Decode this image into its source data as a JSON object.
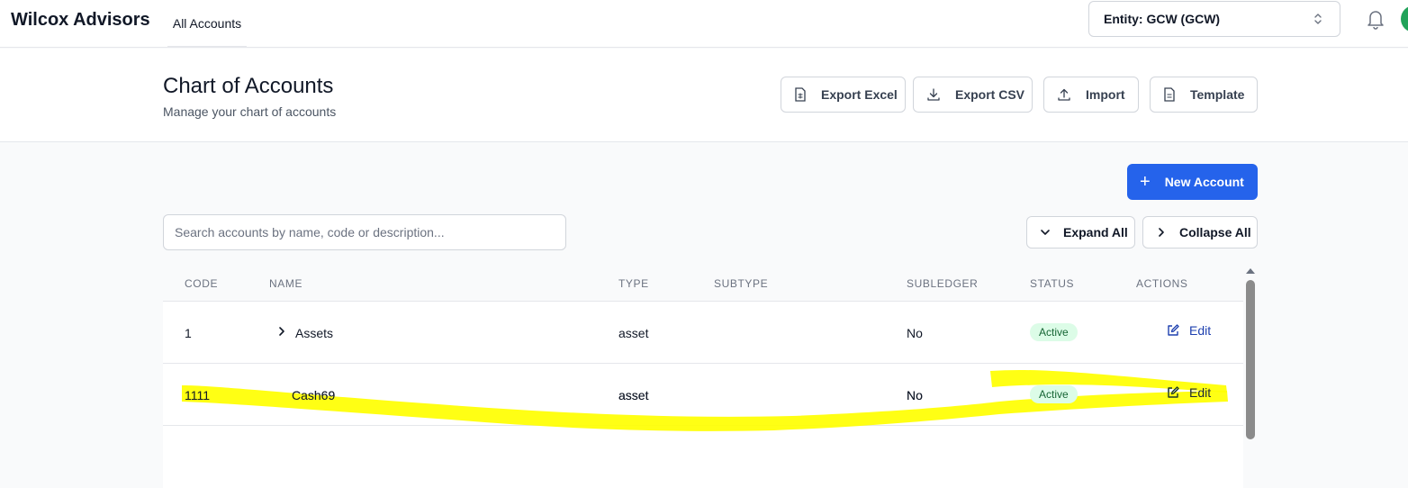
{
  "app": {
    "brand": "Wilcox Advisors"
  },
  "nav": {
    "active_tab": "All Accounts"
  },
  "entity": {
    "label": "Entity: GCW (GCW)"
  },
  "header": {
    "title": "Chart of Accounts",
    "subtitle": "Manage your chart of accounts",
    "buttons": {
      "export_excel": "Export Excel",
      "export_csv": "Export CSV",
      "import": "Import",
      "template": "Template"
    }
  },
  "toolbar": {
    "new_account": "New Account",
    "search_placeholder": "Search accounts by name, code or description...",
    "expand_all": "Expand All",
    "collapse_all": "Collapse All"
  },
  "table": {
    "columns": {
      "code": "CODE",
      "name": "NAME",
      "type": "TYPE",
      "subtype": "SUBTYPE",
      "subledger": "SUBLEDGER",
      "status": "STATUS",
      "actions": "ACTIONS"
    },
    "rows": [
      {
        "code": "1",
        "name": "Assets",
        "type": "asset",
        "subtype": "",
        "subledger": "No",
        "status": "Active",
        "action": "Edit",
        "expandable": true
      },
      {
        "code": "1111",
        "name": "Cash69",
        "type": "asset",
        "subtype": "",
        "subledger": "No",
        "status": "Active",
        "action": "Edit",
        "expandable": false
      }
    ]
  },
  "colors": {
    "primary": "#2563eb",
    "highlight_marker": "#ffff00",
    "status_active_bg": "#dcfce7",
    "status_active_text": "#166534"
  }
}
